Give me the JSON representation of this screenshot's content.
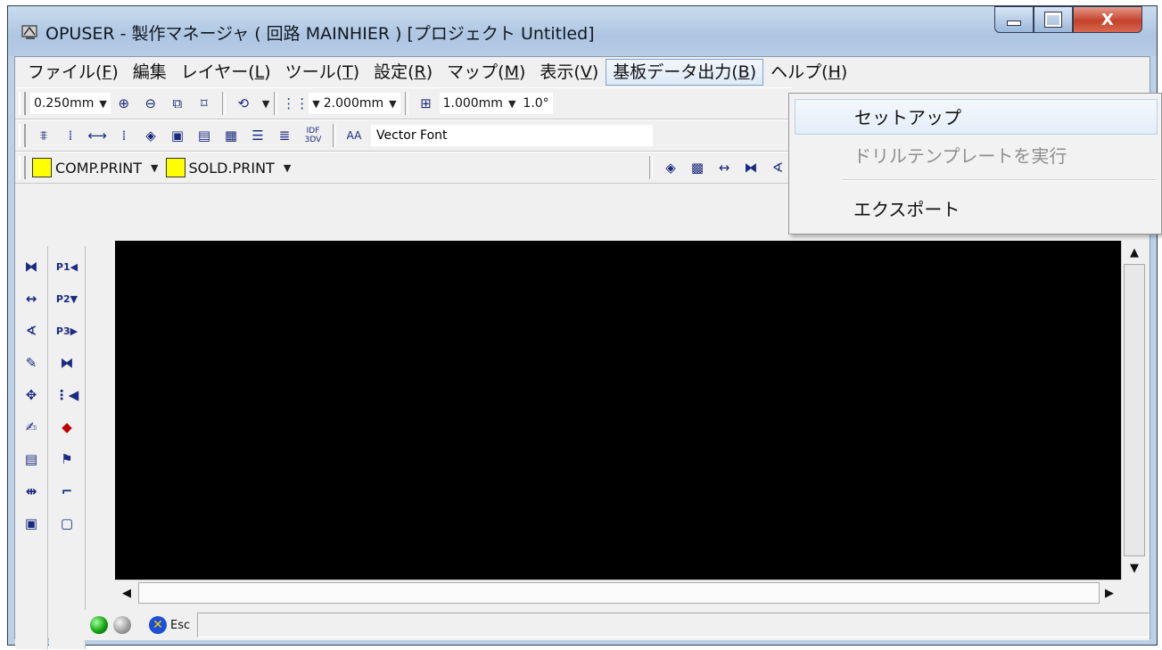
{
  "window": {
    "title": "OPUSER - 製作マネージャ ( 回路 MAINHIER ) [プロジェクト Untitled]",
    "close_glyph": "X"
  },
  "menubar": {
    "items": [
      {
        "label": "ファイル(",
        "key": "F",
        "tail": ")"
      },
      {
        "label": "編集",
        "key": "",
        "tail": ""
      },
      {
        "label": "レイヤー(",
        "key": "L",
        "tail": ")"
      },
      {
        "label": "ツール(",
        "key": "T",
        "tail": ")"
      },
      {
        "label": "設定(",
        "key": "R",
        "tail": ")"
      },
      {
        "label": "マップ(",
        "key": "M",
        "tail": ")"
      },
      {
        "label": "表示(",
        "key": "V",
        "tail": ")"
      },
      {
        "label": "基板データ出力(",
        "key": "B",
        "tail": ")"
      },
      {
        "label": "ヘルプ(",
        "key": "H",
        "tail": ")"
      }
    ]
  },
  "toolbar1": {
    "line_width": "0.250mm",
    "grid": "2.000mm",
    "snap": "1.000mm",
    "angle": "1.0°"
  },
  "toolbar2": {
    "font_prefix": "AA",
    "font_name": "Vector Font",
    "idf_label_1": "IDF",
    "idf_label_2": "3DV"
  },
  "toolbar3": {
    "layer1": "COMP.PRINT",
    "layer2": "SOLD.PRINT"
  },
  "side_toolbar": {
    "p1": "P1",
    "p2": "P2",
    "p3": "P3"
  },
  "statusbar": {
    "esc_label": "Esc"
  },
  "dropdown_menu": {
    "items": [
      "セットアップ",
      "ドリルテンプレートを実行",
      "エクスポート"
    ]
  },
  "colors": {
    "canvas": "#000000",
    "layer_swatch": "#ffff00"
  }
}
